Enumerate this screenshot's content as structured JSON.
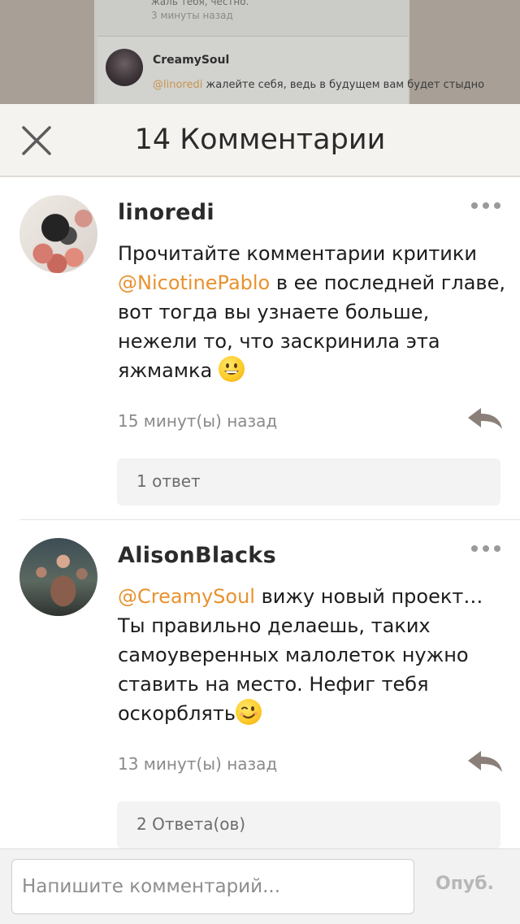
{
  "background": {
    "prev_text": "жаль тебя, честно.",
    "prev_time": "3 минуты назад",
    "item_name": "CreamySoul",
    "item_mention": "@linoredi",
    "item_text": " жалейте себя, ведь в будущем вам будет стыдно"
  },
  "header": {
    "title": "14 Комментарии",
    "close_icon": "close-icon"
  },
  "comments": [
    {
      "username": "linoredi",
      "text_before": "Прочитайте комментарии критики ",
      "mention": "@NicotinePablo",
      "text_after": " в ее последней главе, вот тогда вы узнаете больше, нежели то, что заскринила эта яжмамка ",
      "emoji": "grinning-face",
      "timestamp": "15 минут(ы) назад",
      "replies_label": "1 ответ"
    },
    {
      "username": "AlisonBlacks",
      "mention": "@CreamySoul",
      "text_after": " вижу новый проект… Ты правильно делаешь, таких самоуверенных малолеток нужно ставить на место. Нефиг тебя оскорблять",
      "emoji": "winking-face",
      "timestamp": "13 минут(ы) назад",
      "replies_label": "2 Ответа(ов)"
    }
  ],
  "input": {
    "placeholder": "Напишите комментарий...",
    "publish_label": "Опуб."
  },
  "colors": {
    "accent_mention": "#e8922f",
    "header_bg": "#f5f3ef",
    "replies_bg": "#f3f3f3"
  }
}
